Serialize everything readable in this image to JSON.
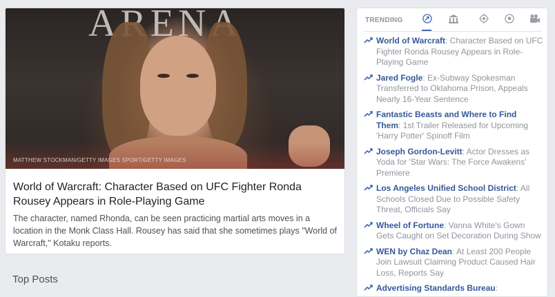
{
  "story": {
    "photo_credit": "MATTHEW STOCKMAN/GETTY IMAGES SPORT/GETTY IMAGES",
    "background_text": "ARENA",
    "headline": "World of Warcraft: Character Based on UFC Fighter Ronda Rousey Appears in Role-Playing Game",
    "summary": "The character, named Rhonda, can be seen practicing martial arts moves in a location in the Monk Class Hall. Rousey has said that she sometimes plays \"World of Warcraft,\" Kotaku reports."
  },
  "section_title": "Top Posts",
  "trending": {
    "title": "TRENDING",
    "categories": [
      {
        "icon": "trending-arrow-icon",
        "active": true
      },
      {
        "icon": "politics-building-icon",
        "active": false
      },
      {
        "icon": "science-technology-icon",
        "active": false
      },
      {
        "icon": "sports-ball-icon",
        "active": false
      },
      {
        "icon": "entertainment-camera-icon",
        "active": false
      }
    ],
    "items": [
      {
        "topic": "World of Warcraft",
        "text": ": Character Based on UFC Fighter Ronda Rousey Appears in Role-Playing Game"
      },
      {
        "topic": "Jared Fogle",
        "text": ": Ex-Subway Spokesman Transferred to Oklahoma Prison, Appeals Nearly 16-Year Sentence"
      },
      {
        "topic": "Fantastic Beasts and Where to Find Them",
        "text": ": 1st Trailer Released for Upcoming 'Harry Potter' Spinoff Film"
      },
      {
        "topic": "Joseph Gordon-Levitt",
        "text": ": Actor Dresses as Yoda for 'Star Wars: The Force Awakens' Premiere"
      },
      {
        "topic": "Los Angeles Unified School District",
        "text": ": All Schools Closed Due to Possible Safety Threat, Officials Say"
      },
      {
        "topic": "Wheel of Fortune",
        "text": ": Vanna White's Gown Gets Caught on Set Decoration During Show"
      },
      {
        "topic": "WEN by Chaz Dean",
        "text": ": At Least 200 People Join Lawsuit Claiming Product Caused Hair Loss, Reports Say"
      },
      {
        "topic": "Advertising Standards Bureau",
        "text": ":"
      }
    ]
  }
}
